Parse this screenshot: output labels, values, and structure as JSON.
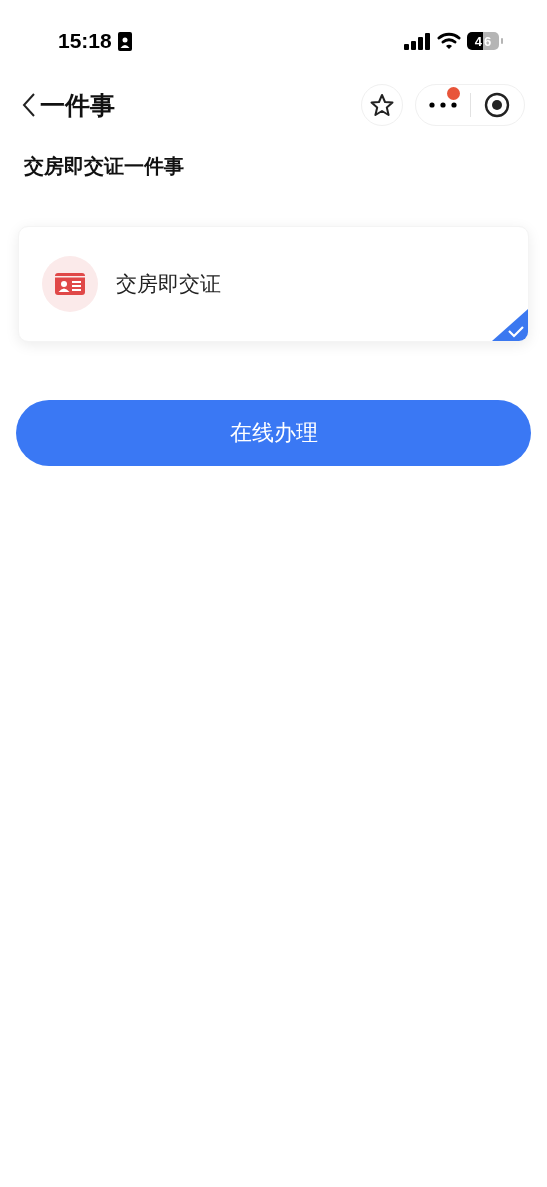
{
  "status_bar": {
    "time": "15:18",
    "battery": "46"
  },
  "nav_bar": {
    "title": "一件事"
  },
  "heading": "交房即交证一件事",
  "options": [
    {
      "label": "交房即交证",
      "selected": true
    }
  ],
  "action_button": "在线办理"
}
